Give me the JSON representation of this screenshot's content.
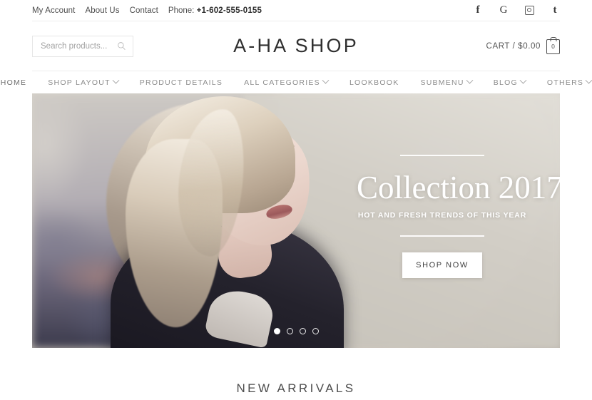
{
  "topbar": {
    "links": [
      {
        "label": "My Account",
        "name": "my-account"
      },
      {
        "label": "About Us",
        "name": "about-us"
      },
      {
        "label": "Contact",
        "name": "contact"
      }
    ],
    "phone_label": "Phone:",
    "phone_number": "+1-602-555-0155",
    "social": [
      {
        "name": "facebook-icon",
        "glyph": "f"
      },
      {
        "name": "google-icon",
        "glyph": "G"
      },
      {
        "name": "instagram-icon",
        "glyph": ""
      },
      {
        "name": "tumblr-icon",
        "glyph": "t"
      }
    ]
  },
  "header": {
    "search_placeholder": "Search products...",
    "search_value": "",
    "logo": "A-HA SHOP",
    "cart_label": "CART / $0.00",
    "cart_count": "0"
  },
  "nav": {
    "items": [
      {
        "label": "HOME",
        "caret": false
      },
      {
        "label": "SHOP LAYOUT",
        "caret": true
      },
      {
        "label": "PRODUCT DETAILS",
        "caret": false
      },
      {
        "label": "ALL CATEGORIES",
        "caret": true
      },
      {
        "label": "LOOKBOOK",
        "caret": false
      },
      {
        "label": "SUBMENU",
        "caret": true
      },
      {
        "label": "BLOG",
        "caret": true
      },
      {
        "label": "OTHERS",
        "caret": true
      }
    ]
  },
  "hero": {
    "title": "Collection 2017",
    "subtitle": "HOT AND FRESH TRENDS OF THIS YEAR",
    "button_label": "SHOP NOW",
    "slides_total": 4,
    "active_slide": 1
  },
  "sections": {
    "new_arrivals": "NEW ARRIVALS"
  },
  "colors": {
    "text_dark": "#2f2f2f",
    "text_muted": "#8d8d8d",
    "divider": "#ededed",
    "hero_overlay": "#ffffff"
  }
}
